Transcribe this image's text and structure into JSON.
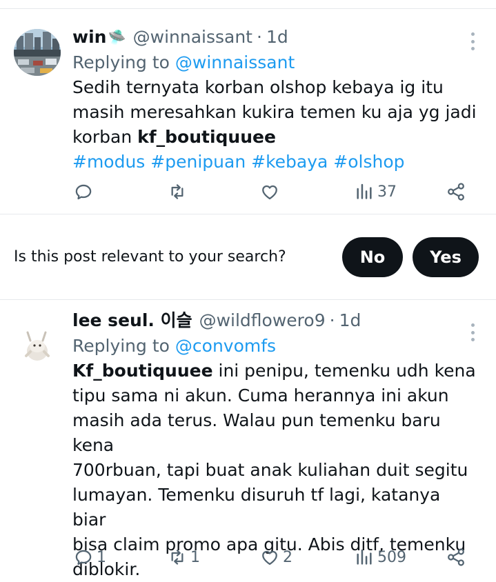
{
  "tweets": [
    {
      "display_name": "win",
      "emoji": "🛸",
      "handle": "@winnaissant",
      "time": "1d",
      "replying_label": "Replying to",
      "replying_to": "@winnaissant",
      "body_lines": [
        "Sedih ternyata korban olshop kebaya ig itu",
        "masih meresahkan kukira temen ku aja yg jadi",
        "korban "
      ],
      "body_bold": "kf_boutiquuee",
      "hashtags": [
        "#modus",
        "#penipuan",
        "#kebaya",
        "#olshop"
      ],
      "stats": {
        "replies": "",
        "reposts": "",
        "likes": "",
        "views": "37"
      }
    },
    {
      "display_name": "lee seul. 이슬",
      "handle": "@wildflowero9",
      "time": "1d",
      "replying_label": "Replying to",
      "replying_to": "@convomfs",
      "body_bold": "Kf_boutiquuee",
      "body_lines": [
        " ini penipu, temenku udh kena",
        "tipu sama ni akun. Cuma herannya ini akun",
        "masih ada terus. Walau pun temenku baru kena",
        "700rbuan, tapi buat anak kuliahan duit segitu",
        "lumayan. Temenku disuruh tf lagi, katanya biar",
        "bisa claim promo apa gitu. Abis ditf, temenku",
        "diblokir."
      ],
      "stats": {
        "replies": "1",
        "reposts": "1",
        "likes": "2",
        "views": "509"
      }
    }
  ],
  "relevance_prompt": {
    "question": "Is this post relevant to your search?",
    "no_label": "No",
    "yes_label": "Yes"
  },
  "colors": {
    "link": "#1d9bf0",
    "muted": "#536471",
    "text": "#0f1419",
    "pill_bg": "#0f1419",
    "divider": "#e6e9ec"
  },
  "icons": [
    "reply-icon",
    "repost-icon",
    "like-icon",
    "views-icon",
    "share-icon",
    "more-options-icon"
  ]
}
